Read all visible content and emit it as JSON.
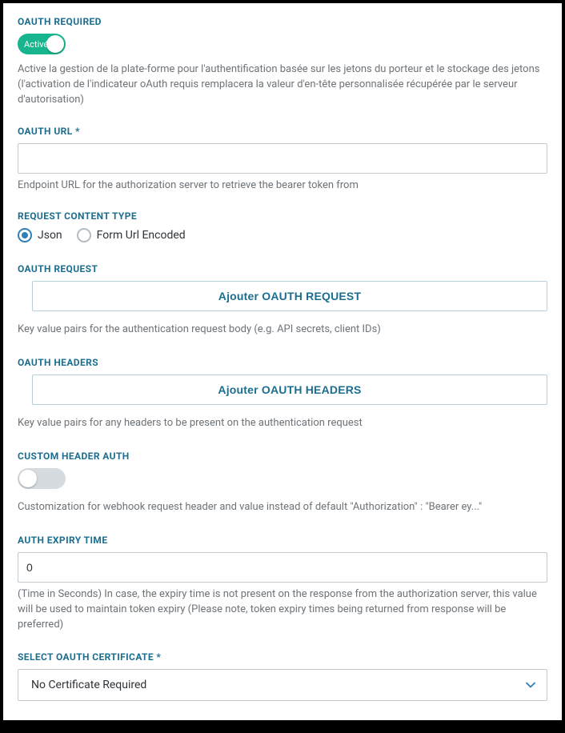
{
  "oauth_required": {
    "label": "OAUTH REQUIRED",
    "toggle_on": true,
    "toggle_on_text": "Activé",
    "helper": "Active la gestion de la plate-forme pour l'authentification basée sur les jetons du porteur et le stockage des jetons (l'activation de l'indicateur oAuth requis remplacera la valeur d'en-tête personnalisée récupérée par le serveur d'autorisation)"
  },
  "oauth_url": {
    "label": "OAUTH URL *",
    "value": "",
    "helper": "Endpoint URL for the authorization server to retrieve the bearer token from"
  },
  "request_content_type": {
    "label": "REQUEST CONTENT TYPE",
    "options": [
      "Json",
      "Form Url Encoded"
    ],
    "selected_index": 0
  },
  "oauth_request": {
    "label": "OAUTH REQUEST",
    "add_button": "Ajouter OAUTH REQUEST",
    "helper": "Key value pairs for the authentication request body (e.g. API secrets, client IDs)"
  },
  "oauth_headers": {
    "label": "OAUTH HEADERS",
    "add_button": "Ajouter OAUTH HEADERS",
    "helper": "Key value pairs for any headers to be present on the authentication request"
  },
  "custom_header_auth": {
    "label": "CUSTOM HEADER AUTH",
    "toggle_on": false,
    "helper": "Customization for webhook request header and value instead of default \"Authorization\" : \"Bearer ey...\""
  },
  "auth_expiry": {
    "label": "AUTH EXPIRY TIME",
    "value": "0",
    "helper": "(Time in Seconds) In case, the expiry time is not present on the response from the authorization server, this value will be used to maintain token expiry (Please note, token expiry times being returned from response will be preferred)"
  },
  "select_certificate": {
    "label": "SELECT OAUTH CERTIFICATE *",
    "selected": "No Certificate Required"
  }
}
